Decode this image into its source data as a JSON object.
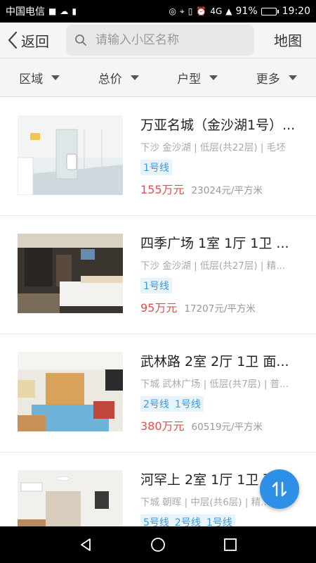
{
  "status_bar": {
    "carrier": "中国电信",
    "network": "4G",
    "battery_percent": "91%",
    "battery_level": 0.91,
    "time": "19:20"
  },
  "header": {
    "back_label": "返回",
    "search_placeholder": "请输入小区名称",
    "search_value": "",
    "map_label": "地图"
  },
  "filters": [
    {
      "label": "区域"
    },
    {
      "label": "总价"
    },
    {
      "label": "户型"
    },
    {
      "label": "更多"
    }
  ],
  "listings": [
    {
      "title": "万亚名城（金沙湖1号）...",
      "meta": "下沙 金沙湖 | 低层(共22层) | 毛坯",
      "tags": [
        "1号线"
      ],
      "price": "155万元",
      "unit_price": "23024元/平方米"
    },
    {
      "title": "四季广场 1室 1厅 1卫 ...",
      "meta": "下沙 金沙湖 | 低层(共27层) | 精...",
      "tags": [
        "1号线"
      ],
      "price": "95万元",
      "unit_price": "17207元/平方米"
    },
    {
      "title": "武林路 2室 2厅 1卫 面...",
      "meta": "下城 武林广场 | 低层(共7层) | 普...",
      "tags": [
        "2号线",
        "1号线"
      ],
      "price": "380万元",
      "unit_price": "60519元/平方米"
    },
    {
      "title": "河罕上 2室 1厅 1卫 面...",
      "meta": "下城 朝晖 | 中层(共6层) | 精...",
      "tags": [
        "5号线",
        "2号线",
        "1号线"
      ],
      "price": "",
      "unit_price": ""
    }
  ],
  "colors": {
    "accent": "#2e8fe6",
    "price": "#e05050",
    "tag_text": "#3a9ad9",
    "tag_bg": "#e8f4fc"
  },
  "icons": {
    "back": "chevron-left-icon",
    "search": "search-icon",
    "filter_caret": "caret-down-icon",
    "fab": "sort-arrows-icon",
    "nav_back": "triangle-back-icon",
    "nav_home": "circle-home-icon",
    "nav_recent": "square-recent-icon"
  }
}
